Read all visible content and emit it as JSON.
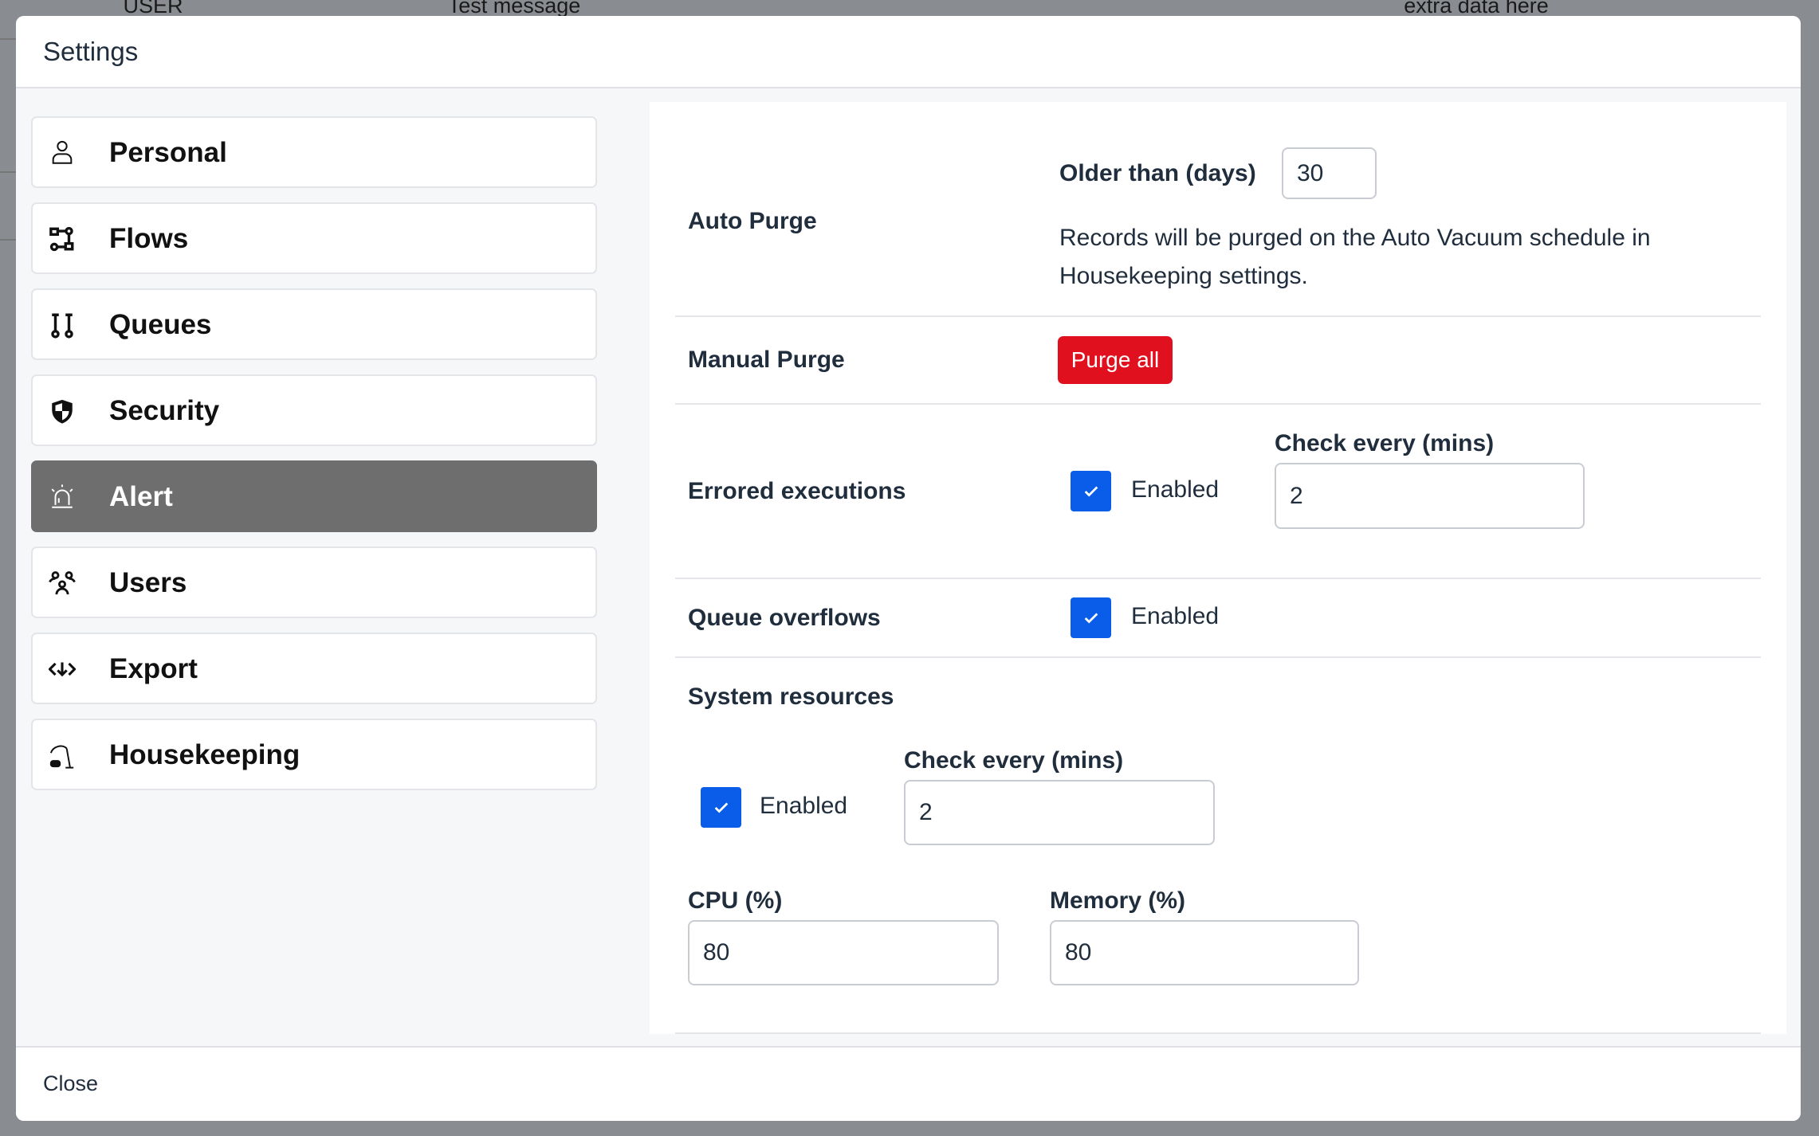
{
  "background": {
    "columns": [
      "USER",
      "Test message",
      "extra data here"
    ]
  },
  "modal": {
    "title": "Settings",
    "close_label": "Close"
  },
  "sidebar": {
    "items": [
      {
        "label": "Personal",
        "icon": "person-icon"
      },
      {
        "label": "Flows",
        "icon": "flows-icon"
      },
      {
        "label": "Queues",
        "icon": "queues-icon"
      },
      {
        "label": "Security",
        "icon": "shield-icon"
      },
      {
        "label": "Alert",
        "icon": "alarm-icon",
        "active": true
      },
      {
        "label": "Users",
        "icon": "users-icon"
      },
      {
        "label": "Export",
        "icon": "export-icon"
      },
      {
        "label": "Housekeeping",
        "icon": "vacuum-icon"
      }
    ]
  },
  "content": {
    "auto_purge": {
      "label": "Auto Purge",
      "older_label": "Older than (days)",
      "older_value": "30",
      "description_line1": "Records will be purged on the Auto Vacuum schedule in",
      "description_line2": "Housekeeping settings."
    },
    "manual_purge": {
      "label": "Manual Purge",
      "button": "Purge all"
    },
    "errored": {
      "label": "Errored executions",
      "enabled_label": "Enabled",
      "enabled": true,
      "check_label": "Check every (mins)",
      "check_value": "2"
    },
    "queue_overflows": {
      "label": "Queue overflows",
      "enabled_label": "Enabled",
      "enabled": true
    },
    "system": {
      "label": "System resources",
      "enabled_label": "Enabled",
      "enabled": true,
      "check_label": "Check every (mins)",
      "check_value": "2",
      "cpu_label": "CPU (%)",
      "cpu_value": "80",
      "memory_label": "Memory (%)",
      "memory_value": "80"
    }
  },
  "colors": {
    "accent": "#0a5de8",
    "danger": "#e0101f",
    "active_nav": "#6e6e6e"
  }
}
